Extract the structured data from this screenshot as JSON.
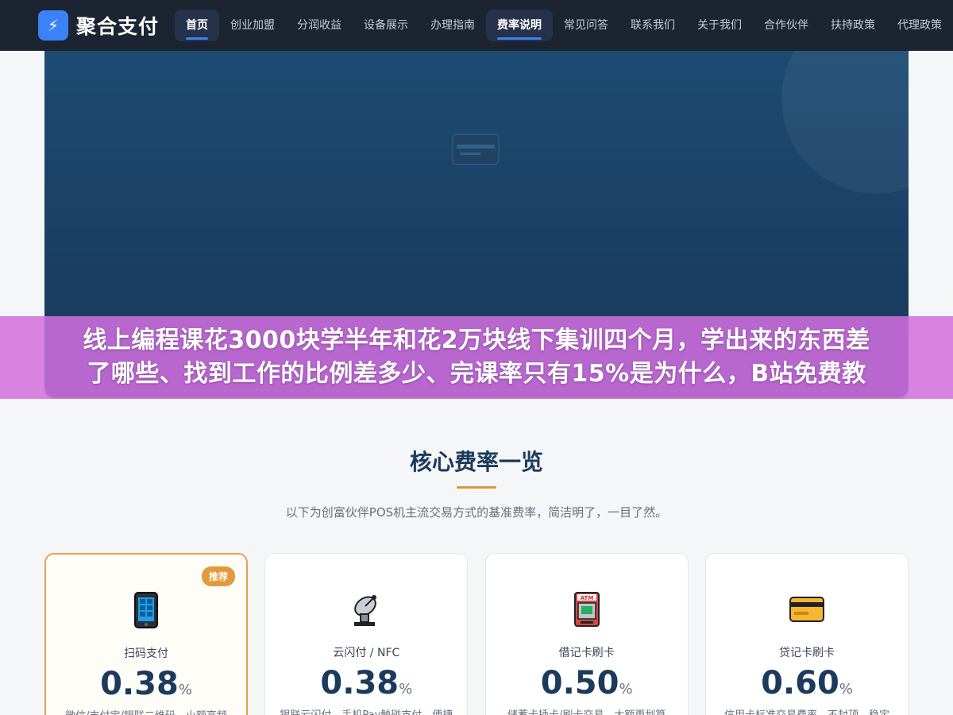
{
  "brand": {
    "logo_glyph": "⚡",
    "name": "聚合支付"
  },
  "nav": {
    "items": [
      {
        "label": "首页",
        "active": true
      },
      {
        "label": "创业加盟",
        "active": false
      },
      {
        "label": "分润收益",
        "active": false
      },
      {
        "label": "设备展示",
        "active": false
      },
      {
        "label": "办理指南",
        "active": false
      },
      {
        "label": "费率说明",
        "active": true
      },
      {
        "label": "常见问答",
        "active": false
      },
      {
        "label": "联系我们",
        "active": false
      },
      {
        "label": "关于我们",
        "active": false
      },
      {
        "label": "合作伙伴",
        "active": false
      },
      {
        "label": "扶持政策",
        "active": false
      },
      {
        "label": "代理政策",
        "active": false
      }
    ]
  },
  "banner": {
    "line1": "线上编程课花3000块学半年和花2万块线下集训四个月，学出来的东西差",
    "line2": "了哪些、找到工作的比例差多少、完课率只有15%是为什么，B站免费教"
  },
  "section": {
    "title": "核心费率一览",
    "subtitle": "以下为创富伙伴POS机主流交易方式的基准费率，简洁明了，一目了然。"
  },
  "cards": [
    {
      "icon": "mobile-phone-icon",
      "badge": "推荐",
      "title": "扫码支付",
      "rate": "0.38",
      "unit": "%",
      "desc": "微信/支付宝/银联二维码，小额高频"
    },
    {
      "icon": "satellite-dish-icon",
      "badge": "",
      "title": "云闪付 / NFC",
      "rate": "0.38",
      "unit": "%",
      "desc": "银联云闪付、手机Pay触碰支付，便捷"
    },
    {
      "icon": "atm-icon",
      "badge": "",
      "title": "借记卡刷卡",
      "rate": "0.50",
      "unit": "%",
      "desc": "储蓄卡插卡/刷卡交易，大额更划算"
    },
    {
      "icon": "credit-card-icon",
      "badge": "",
      "title": "贷记卡刷卡",
      "rate": "0.60",
      "unit": "%",
      "desc": "信用卡标准交易费率，不封顶，稳定"
    }
  ],
  "colors": {
    "accent": "#3b82f6",
    "brand_dark": "#1b3a5c",
    "highlight": "#e39a3a"
  }
}
